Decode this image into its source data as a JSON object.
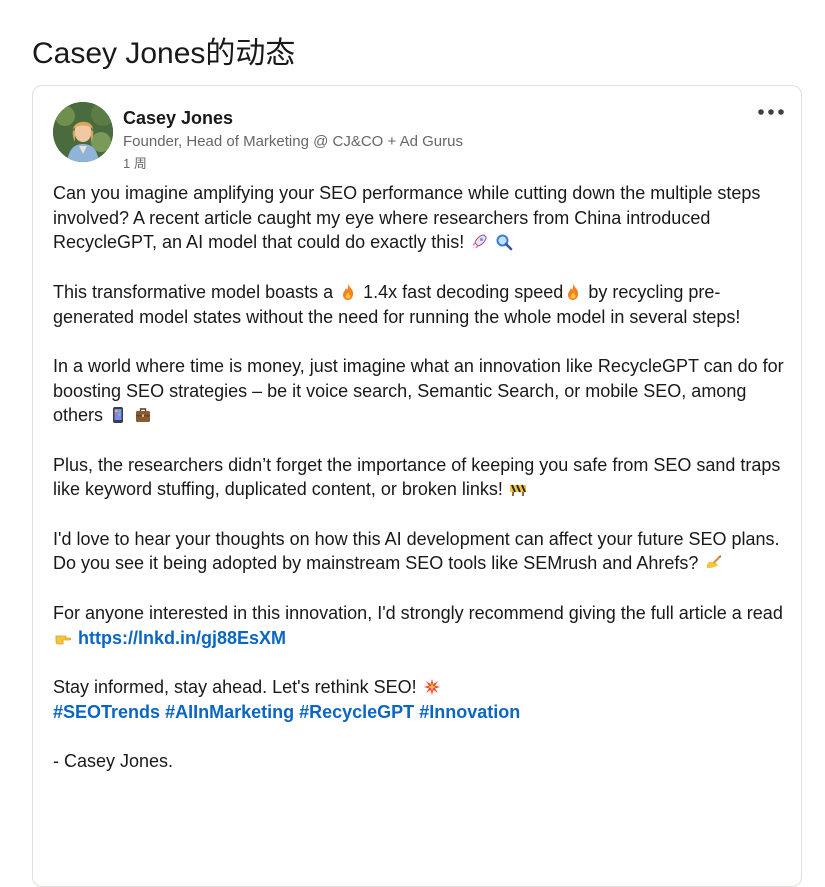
{
  "page": {
    "heading": "Casey Jones的动态"
  },
  "post": {
    "author": {
      "name": "Casey Jones",
      "headline": "Founder, Head of Marketing @ CJ&CO + Ad Gurus",
      "time": "1 周"
    },
    "more_icon": "ellipsis-icon",
    "body": {
      "p1": "Can you imagine amplifying your SEO performance while cutting down the multiple steps involved? A recent article caught my eye where researchers from China introduced RecycleGPT, an AI model that could do exactly this!",
      "p2a": "This transformative model boasts a",
      "p2b": "1.4x fast decoding speed",
      "p2c": "by recycling pre-generated model states without the need for running the whole model in several steps!",
      "p3": "In a world where time is money, just imagine what an innovation like RecycleGPT can do for boosting SEO strategies – be it voice search, Semantic Search, or mobile SEO, among others",
      "p4": "Plus, the researchers didn’t forget the importance of keeping you safe from SEO sand traps like keyword stuffing, duplicated content, or broken links!",
      "p5": "I'd love to hear your thoughts on how this AI development can affect your future SEO plans. Do you see it being adopted by mainstream SEO tools like SEMrush and Ahrefs?",
      "p6": "For anyone interested in this innovation, I'd strongly recommend giving the full article a read",
      "link": "https://lnkd.in/gj88EsXM",
      "p7": "Stay informed, stay ahead. Let's rethink SEO!",
      "hashtags": [
        "#SEOTrends",
        "#AIInMarketing",
        "#RecycleGPT",
        "#Innovation"
      ],
      "signoff": "- Casey Jones."
    },
    "emojis": [
      "rocket-icon",
      "magnifier-icon",
      "fire-icon",
      "fire-icon",
      "mobile-phone-icon",
      "briefcase-icon",
      "construction-icon",
      "writing-hand-icon",
      "pointing-hand-icon",
      "collision-icon"
    ],
    "colors": {
      "link": "#0a66c2",
      "text": "#191919",
      "secondary": "#666666"
    }
  }
}
